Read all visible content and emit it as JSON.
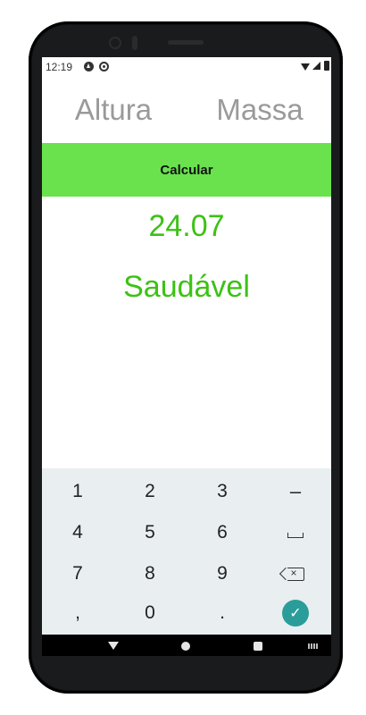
{
  "status_bar": {
    "time": "12:19",
    "icons": [
      "notification-a-icon",
      "notification-at-icon",
      "wifi-icon",
      "signal-icon",
      "battery-icon"
    ]
  },
  "inputs": {
    "altura_placeholder": "Altura",
    "massa_placeholder": "Massa"
  },
  "calculate_button": {
    "label": "Calcular",
    "color": "#69e24e"
  },
  "result": {
    "value": "24.07",
    "classification": "Saudável",
    "color": "#3bc214"
  },
  "keyboard": {
    "row1": [
      "1",
      "2",
      "3",
      "–"
    ],
    "row2": [
      "4",
      "5",
      "6"
    ],
    "row3": [
      "7",
      "8",
      "9"
    ],
    "row4": [
      ",",
      "0",
      "."
    ],
    "space_icon": "space-icon",
    "backspace_icon": "backspace-icon",
    "backspace_glyph": "×",
    "done_icon": "check-icon",
    "done_glyph": "✓",
    "done_color": "#2a9d9a",
    "background": "#e9eef0"
  },
  "navigation_bar": {
    "icons": [
      "back-icon",
      "home-icon",
      "recents-icon",
      "keyboard-switch-icon"
    ]
  }
}
